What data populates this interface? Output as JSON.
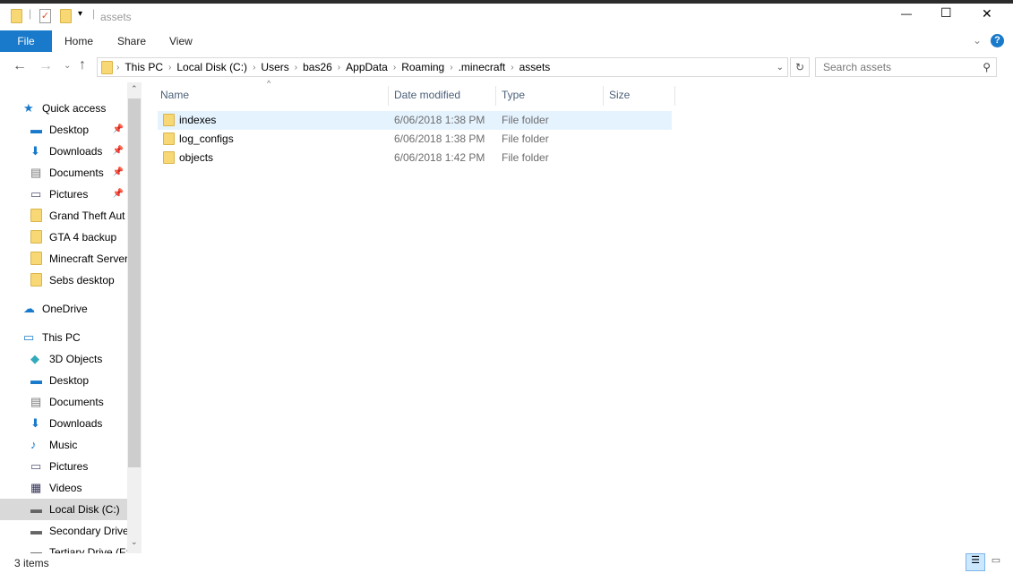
{
  "window": {
    "title": "assets",
    "min": "—",
    "max": "☐",
    "close": "✕"
  },
  "ribbon": {
    "file": "File",
    "home": "Home",
    "share": "Share",
    "view": "View",
    "help": "?"
  },
  "address": {
    "crumbs": [
      "This PC",
      "Local Disk (C:)",
      "Users",
      "bas26",
      "AppData",
      "Roaming",
      ".minecraft",
      "assets"
    ]
  },
  "search": {
    "placeholder": "Search assets"
  },
  "sidebar": {
    "items": [
      {
        "label": "Quick access",
        "icon": "star-icon",
        "top": true
      },
      {
        "label": "Desktop",
        "icon": "desktop-icon",
        "pin": true
      },
      {
        "label": "Downloads",
        "icon": "download-icon",
        "pin": true
      },
      {
        "label": "Documents",
        "icon": "documents-icon",
        "pin": true
      },
      {
        "label": "Pictures",
        "icon": "pictures-icon",
        "pin": true
      },
      {
        "label": "Grand Theft Aut",
        "icon": "folder-icon"
      },
      {
        "label": "GTA 4 backup",
        "icon": "folder-icon"
      },
      {
        "label": "Minecraft Server",
        "icon": "folder-icon"
      },
      {
        "label": "Sebs desktop",
        "icon": "folder-icon"
      },
      {
        "label": "OneDrive",
        "icon": "cloud-icon",
        "top": true
      },
      {
        "label": "This PC",
        "icon": "computer-icon",
        "top": true
      },
      {
        "label": "3D Objects",
        "icon": "cube-icon"
      },
      {
        "label": "Desktop",
        "icon": "desktop-icon"
      },
      {
        "label": "Documents",
        "icon": "documents-icon"
      },
      {
        "label": "Downloads",
        "icon": "download-icon"
      },
      {
        "label": "Music",
        "icon": "music-icon"
      },
      {
        "label": "Pictures",
        "icon": "pictures-icon"
      },
      {
        "label": "Videos",
        "icon": "videos-icon"
      },
      {
        "label": "Local Disk (C:)",
        "icon": "drive-icon",
        "selected": true
      },
      {
        "label": "Secondary Drive",
        "icon": "drive-icon"
      },
      {
        "label": "Tertiary Drive (F:",
        "icon": "drive-icon"
      }
    ]
  },
  "columns": {
    "name": "Name",
    "date": "Date modified",
    "type": "Type",
    "size": "Size"
  },
  "files": [
    {
      "name": "indexes",
      "date": "6/06/2018 1:38 PM",
      "type": "File folder"
    },
    {
      "name": "log_configs",
      "date": "6/06/2018 1:38 PM",
      "type": "File folder"
    },
    {
      "name": "objects",
      "date": "6/06/2018 1:42 PM",
      "type": "File folder"
    }
  ],
  "status": {
    "count": "3 items"
  }
}
